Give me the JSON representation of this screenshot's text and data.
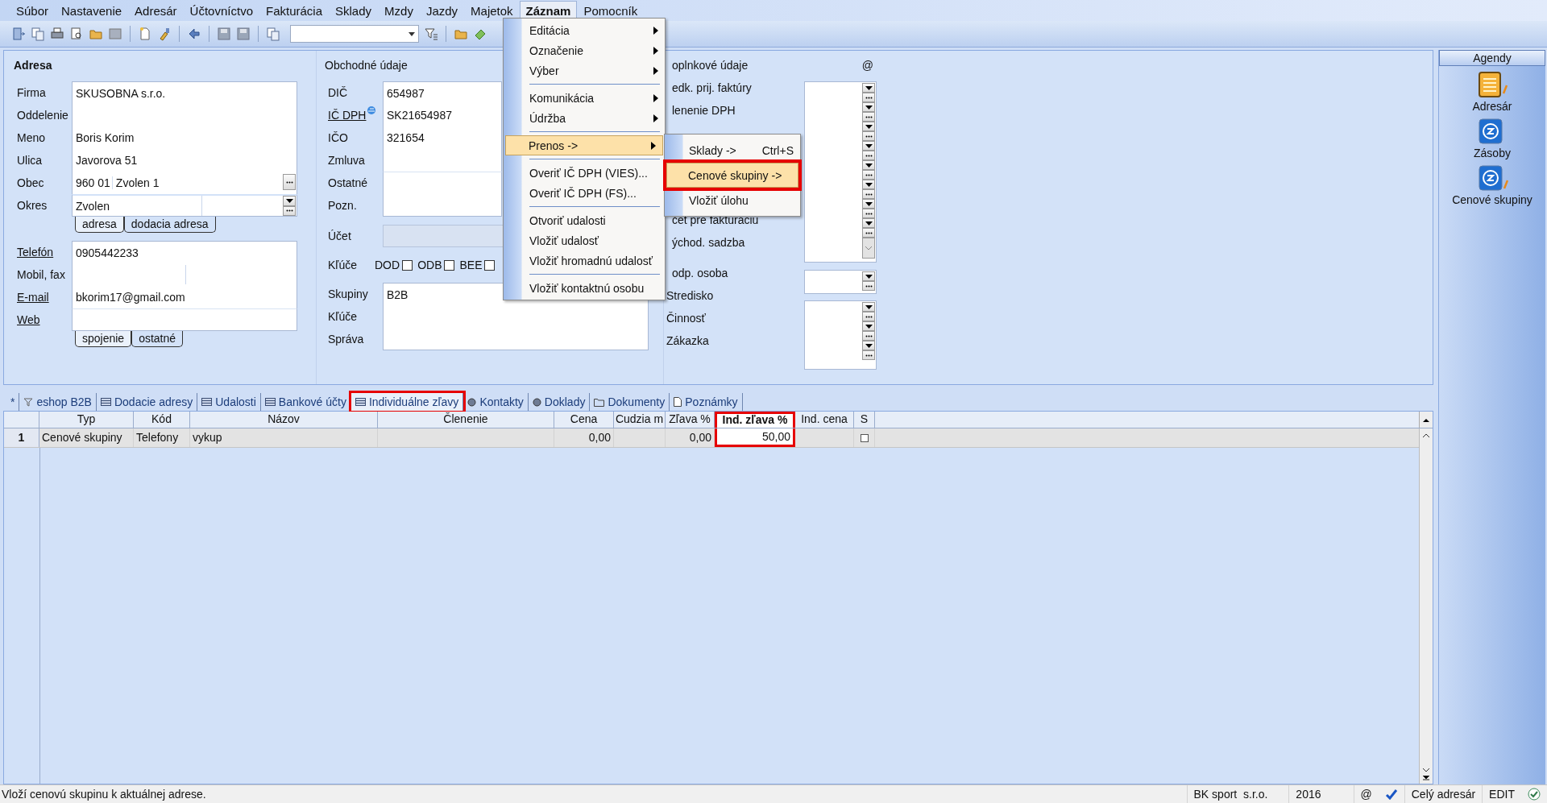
{
  "menu_bar": [
    {
      "label": "Súbor",
      "selected": false
    },
    {
      "label": "Nastavenie",
      "selected": false
    },
    {
      "label": "Adresár",
      "selected": false
    },
    {
      "label": "Účtovníctvo",
      "selected": false
    },
    {
      "label": "Fakturácia",
      "selected": false
    },
    {
      "label": "Sklady",
      "selected": false
    },
    {
      "label": "Mzdy",
      "selected": false
    },
    {
      "label": "Jazdy",
      "selected": false
    },
    {
      "label": "Majetok",
      "selected": false
    },
    {
      "label": "Záznam",
      "selected": true
    },
    {
      "label": "Pomocník",
      "selected": false
    }
  ],
  "address": {
    "title": "Adresa",
    "fields": [
      {
        "label": "Firma",
        "value": "SKUSOBNA s.r.o.",
        "kind": "text",
        "link": false
      },
      {
        "label": "Oddelenie",
        "kind": "text",
        "link": false
      },
      {
        "label": "Meno",
        "value": "Boris Korim",
        "kind": "text",
        "link": false
      },
      {
        "label": "Ulica",
        "value": "Javorova 51",
        "kind": "text",
        "link": false
      },
      {
        "label": "Obec",
        "value": "960 01",
        "value_2": "Zvolen 1",
        "kind": "lookup",
        "link": false
      },
      {
        "label": "Okres",
        "value": "Zvolen",
        "kind": "dropdown",
        "link": false
      }
    ],
    "tabs": [
      {
        "label": "adresa",
        "selected": true
      },
      {
        "label": "dodacia adresa",
        "selected": false
      }
    ],
    "contacts": [
      {
        "label": "Telefón",
        "value": "0905442233",
        "kind": "text",
        "link": true
      },
      {
        "label": "Mobil, fax",
        "kind": "split",
        "link": false
      },
      {
        "label": "E-mail",
        "value": "bkorim17@gmail.com",
        "kind": "text",
        "link": true
      },
      {
        "label": "Web",
        "kind": "text",
        "link": true
      }
    ],
    "contact_tabs": [
      {
        "label": "spojenie",
        "selected": true
      },
      {
        "label": "ostatné",
        "selected": false
      }
    ]
  },
  "business": {
    "title": "Obchodné údaje",
    "fields": [
      {
        "label": "DIČ",
        "value": "654987",
        "link": false
      },
      {
        "label": "IČ DPH",
        "value": "SK21654987",
        "link": true
      },
      {
        "label": "IČO",
        "value": "321654",
        "link": false
      },
      {
        "label": "Zmluva",
        "link": false
      },
      {
        "label": "Ostatné",
        "link": false
      },
      {
        "label": "Pozn.",
        "link": false
      }
    ],
    "account_label": "Účet",
    "keys_label": "Kľúče",
    "key_checks": [
      {
        "label": "DOD",
        "checked": false
      },
      {
        "label": "ODB",
        "checked": false
      },
      {
        "label": "BEE",
        "checked": false
      }
    ],
    "groups": [
      {
        "label": "Skupiny",
        "value": "B2B"
      },
      {
        "label": "Kľúče"
      },
      {
        "label": "Správa"
      }
    ]
  },
  "extra": {
    "title": "oplnkové údaje",
    "at": "@",
    "rows_top": [
      "edk. prij. faktúry",
      "lenenie DPH"
    ],
    "rows_mid": [
      "čet pre fakturáciu",
      "ýchod. sadzba"
    ],
    "person": "odp. osoba",
    "rows_bottom": [
      "Stredisko",
      "Činnosť",
      "Zákazka"
    ]
  },
  "menu": {
    "groups": [
      [
        {
          "label": "Editácia",
          "submenu": true,
          "selected": false
        },
        {
          "label": "Označenie",
          "submenu": true,
          "selected": false
        },
        {
          "label": "Výber",
          "submenu": true,
          "selected": false
        }
      ],
      [
        {
          "label": "Komunikácia",
          "submenu": true,
          "selected": false
        },
        {
          "label": "Údržba",
          "submenu": true,
          "selected": false
        }
      ],
      [
        {
          "label": "Prenos ->",
          "submenu": true,
          "selected": true
        }
      ],
      [
        {
          "label": "Overiť IČ DPH (VIES)...",
          "submenu": false,
          "selected": false
        },
        {
          "label": "Overiť IČ DPH (FS)...",
          "submenu": false,
          "selected": false
        }
      ],
      [
        {
          "label": "Otvoriť udalosti",
          "submenu": false,
          "selected": false
        },
        {
          "label": "Vložiť udalosť",
          "submenu": false,
          "selected": false
        },
        {
          "label": "Vložiť hromadnú udalosť",
          "submenu": false,
          "selected": false
        }
      ],
      [
        {
          "label": "Vložiť kontaktnú osobu",
          "submenu": false,
          "selected": false
        }
      ]
    ]
  },
  "submenu": [
    {
      "label": "Sklady ->",
      "shortcut": "Ctrl+S",
      "selected": false,
      "marked": false
    },
    {
      "label": "Cenové skupiny ->",
      "selected": true,
      "marked": true
    },
    {
      "label": "Vložiť úlohu",
      "selected": false,
      "marked": false
    }
  ],
  "tabs": [
    {
      "label": "*",
      "selected": false,
      "marked": false
    },
    {
      "label": "eshop B2B",
      "selected": false,
      "marked": false
    },
    {
      "label": "Dodacie adresy",
      "selected": false,
      "marked": false
    },
    {
      "label": "Udalosti",
      "selected": false,
      "marked": false
    },
    {
      "label": "Bankové účty",
      "selected": false,
      "marked": false
    },
    {
      "label": "Individuálne zľavy",
      "selected": true,
      "marked": true
    },
    {
      "label": "Kontakty",
      "selected": false,
      "marked": false
    },
    {
      "label": "Doklady",
      "selected": false,
      "marked": false
    },
    {
      "label": "Dokumenty",
      "selected": false,
      "marked": false
    },
    {
      "label": "Poznámky",
      "selected": false,
      "marked": false
    }
  ],
  "table": {
    "columns": [
      {
        "label": "Typ",
        "active": false,
        "marked": false
      },
      {
        "label": "Kód",
        "active": false,
        "marked": false
      },
      {
        "label": "Názov",
        "active": false,
        "marked": false
      },
      {
        "label": "Členenie",
        "active": false,
        "marked": false
      },
      {
        "label": "Cena",
        "active": false,
        "marked": false
      },
      {
        "label": "Cudzia m",
        "active": false,
        "marked": false
      },
      {
        "label": "Zľava %",
        "active": false,
        "marked": false
      },
      {
        "label": "Ind. zľava %",
        "active": true,
        "marked": true
      },
      {
        "label": "Ind. cena",
        "active": false,
        "marked": false
      },
      {
        "label": "S",
        "active": false,
        "marked": false
      }
    ],
    "rows": [
      {
        "number": "1",
        "cells": [
          "Cenové skupiny",
          "Telefony",
          "vykup",
          null,
          "0,00",
          null,
          "0,00",
          "50,00",
          null
        ],
        "checked": false
      }
    ]
  },
  "agendy": {
    "title": "Agendy",
    "items": [
      {
        "label": "Adresár"
      },
      {
        "label": "Zásoby"
      },
      {
        "label": "Cenové skupiny"
      }
    ]
  },
  "status_bar": {
    "message": "Vloží cenovú skupinu k aktuálnej adrese.",
    "company": "BK sport  s.r.o.",
    "year": "2016",
    "at": "@",
    "scope": "Celý adresár",
    "mode": "EDIT"
  }
}
